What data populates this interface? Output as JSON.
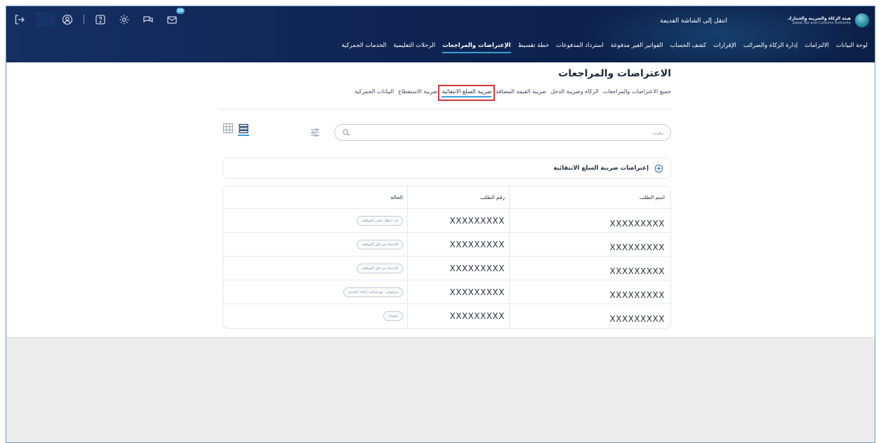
{
  "header": {
    "logo_ar": "هيئة الزكاة والضريبة والجمارك",
    "logo_en": "Zakat,Tax and Customs Authority",
    "old_screen_link": "انتقل إلى الشاشة القديمة",
    "mail_badge": "20",
    "icons": [
      "logout-icon",
      "user-icon",
      "help-icon",
      "settings-icon",
      "chat-icon",
      "mail-icon"
    ]
  },
  "nav": {
    "items": [
      {
        "label": "لوحة البيانات",
        "active": false
      },
      {
        "label": "الالتزامات",
        "active": false
      },
      {
        "label": "إدارة الزكاة والضرائب",
        "active": false
      },
      {
        "label": "الإقرارات",
        "active": false
      },
      {
        "label": "كشف الحساب",
        "active": false
      },
      {
        "label": "الفواتير الغير مدفوعة",
        "active": false
      },
      {
        "label": "استرداد المدفوعات",
        "active": false
      },
      {
        "label": "خطة تقسيط",
        "active": false
      },
      {
        "label": "الإعتراضات والمراجعات",
        "active": true
      },
      {
        "label": "الرحلات التعليمية",
        "active": false
      },
      {
        "label": "الخدمات الجمركية",
        "active": false
      }
    ]
  },
  "page": {
    "title": "الاعتراضات والمراجعات"
  },
  "tabs": [
    {
      "label": "جميع الاعتراضات والمراجعات",
      "active": false
    },
    {
      "label": "الزكاة وضريبة الدخل",
      "active": false
    },
    {
      "label": "ضريبة القيمة المضافة",
      "active": false
    },
    {
      "label": "ضريبة السلع الانتقائية",
      "active": true
    },
    {
      "label": "ضريبة الاستقطاع",
      "active": false
    },
    {
      "label": "البيانات الجمركية",
      "active": false
    }
  ],
  "search": {
    "placeholder": "بحث",
    "value": ""
  },
  "section": {
    "title": "إعتراضات ضريبة السلع الانتقائية"
  },
  "table": {
    "headers": [
      "اسم الطلب",
      "رقم الطلب",
      "الحالة"
    ],
    "rows": [
      {
        "name": "XXXXXXXXX",
        "number": "XXXXXXXXX",
        "status": "في انتظار تعيين الموظف"
      },
      {
        "name": "XXXXXXXXX",
        "number": "XXXXXXXXX",
        "status": "الإعتماد من قبل الموظف"
      },
      {
        "name": "XXXXXXXXX",
        "number": "XXXXXXXXX",
        "status": "الإعتماد من قبل الموظف"
      },
      {
        "name": "XXXXXXXXX",
        "number": "XXXXXXXXX",
        "status": "مرفوض - مع امكانية إعادة التقديم"
      },
      {
        "name": "XXXXXXXXX",
        "number": "XXXXXXXXX",
        "status": "مقبولة"
      }
    ]
  }
}
